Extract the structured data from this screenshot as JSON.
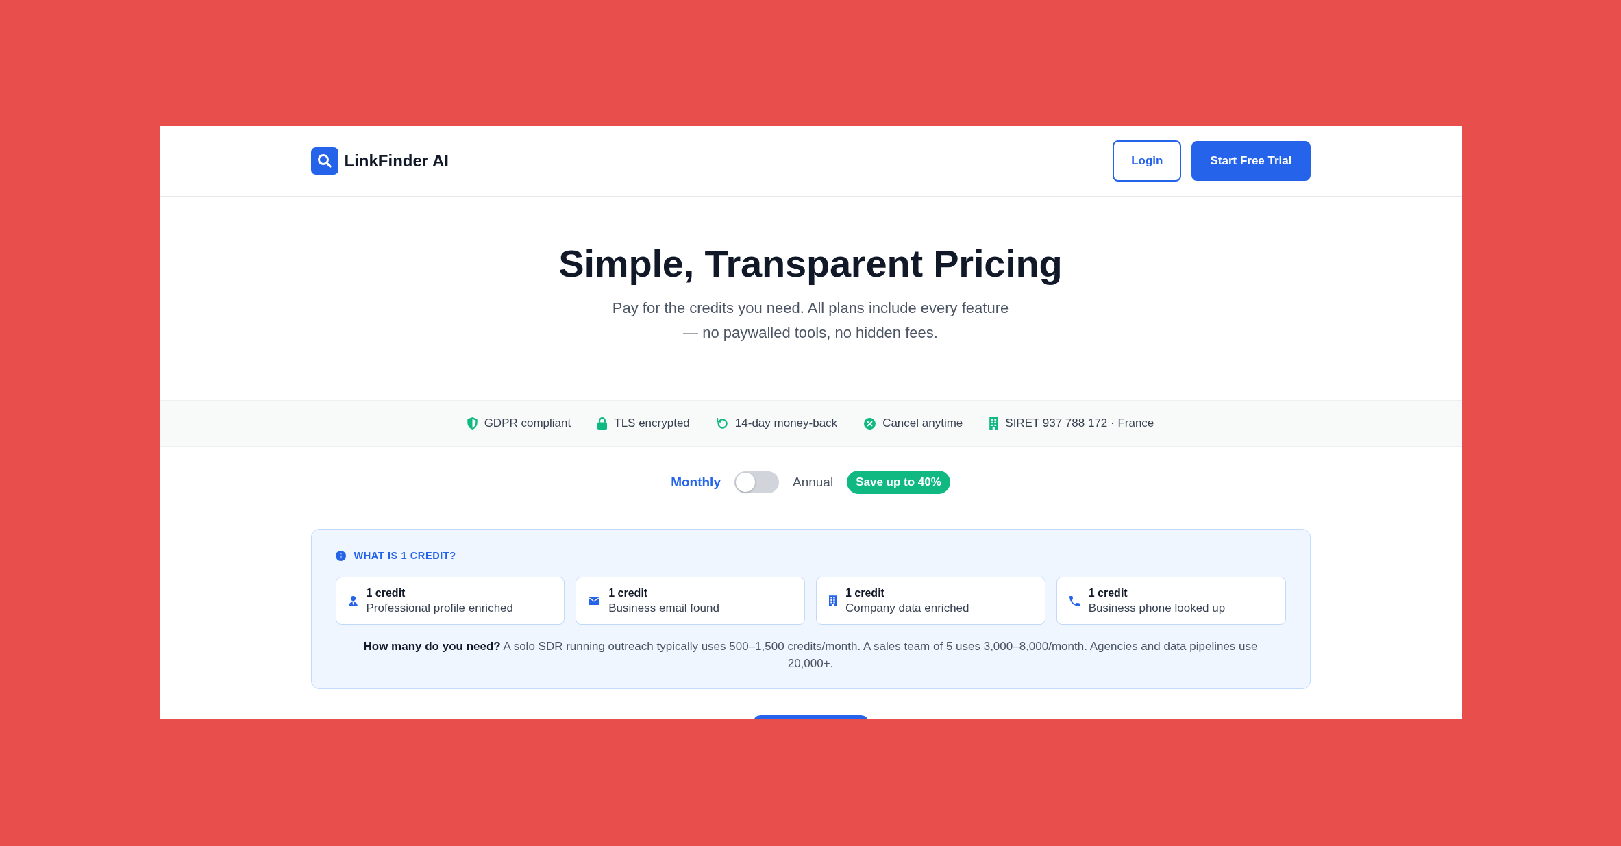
{
  "header": {
    "brand": "LinkFinder AI",
    "buttons": [
      {
        "label": "Login",
        "kind": "outline"
      },
      {
        "label": "Start Free Trial",
        "kind": "primary"
      }
    ]
  },
  "hero": {
    "title": "Simple, Transparent Pricing",
    "subtitle": "Pay for the credits you need. All plans include every feature — no paywalled tools, no hidden fees."
  },
  "trust_badges": [
    "GDPR compliant",
    "TLS encrypted",
    "14-day money-back",
    "Cancel anytime",
    "SIRET 937 788 172 · France"
  ],
  "billing": {
    "options": [
      {
        "label": "Monthly",
        "selected": true
      },
      {
        "label": "Annual",
        "selected": false
      }
    ],
    "toggle_on": false,
    "badge": "Save up to 40%"
  },
  "credit_info": {
    "title": "WHAT IS 1 CREDIT?",
    "items": [
      {
        "amount": "1 credit",
        "description": "Professional profile enriched"
      },
      {
        "amount": "1 credit",
        "description": "Business email found"
      },
      {
        "amount": "1 credit",
        "description": "Company data enriched"
      },
      {
        "amount": "1 credit",
        "description": "Business phone looked up"
      }
    ],
    "note": "**How many do you need?** A solo SDR running outreach typically uses 500–1,500 credits/month. A sales team of 5 uses 3,000–8,000/month. Agencies and data pipelines use 20,000+."
  }
}
